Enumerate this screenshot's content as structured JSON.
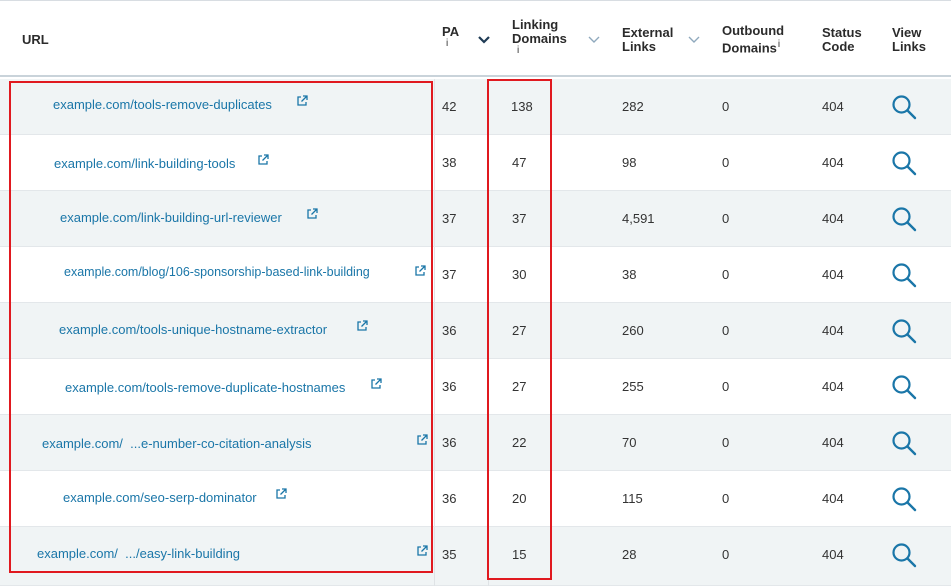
{
  "columns": {
    "url": "URL",
    "pa": "PA",
    "pa_info": "i",
    "linking_domains_1": "Linking",
    "linking_domains_2": "Domains",
    "linking_info": "i",
    "external_links_1": "External",
    "external_links_2": "Links",
    "outbound_domains_1": "Outbound",
    "outbound_domains_2": "Domains",
    "outbound_info": "i",
    "status_code_1": "Status",
    "status_code_2": "Code",
    "view_links_1": "View",
    "view_links_2": "Links"
  },
  "rows": [
    {
      "url": "example.com/tools-remove-duplicates",
      "pa": "42",
      "linking_domains": "138",
      "external_links": "282",
      "outbound_domains": "0",
      "status_code": "404"
    },
    {
      "url": "example.com/link-building-tools",
      "pa": "38",
      "linking_domains": "47",
      "external_links": "98",
      "outbound_domains": "0",
      "status_code": "404"
    },
    {
      "url": "example.com/link-building-url-reviewer",
      "pa": "37",
      "linking_domains": "37",
      "external_links": "4,591",
      "outbound_domains": "0",
      "status_code": "404"
    },
    {
      "url": "example.com/blog/106-sponsorship-based-link-building",
      "pa": "37",
      "linking_domains": "30",
      "external_links": "38",
      "outbound_domains": "0",
      "status_code": "404"
    },
    {
      "url": "example.com/tools-unique-hostname-extractor",
      "pa": "36",
      "linking_domains": "27",
      "external_links": "260",
      "outbound_domains": "0",
      "status_code": "404"
    },
    {
      "url": "example.com/tools-remove-duplicate-hostnames",
      "pa": "36",
      "linking_domains": "27",
      "external_links": "255",
      "outbound_domains": "0",
      "status_code": "404"
    },
    {
      "url": "example.com/  ...e-number-co-citation-analysis",
      "pa": "36",
      "linking_domains": "22",
      "external_links": "70",
      "outbound_domains": "0",
      "status_code": "404"
    },
    {
      "url": "example.com/seo-serp-dominator",
      "pa": "36",
      "linking_domains": "20",
      "external_links": "115",
      "outbound_domains": "0",
      "status_code": "404"
    },
    {
      "url": "example.com/  .../easy-link-building",
      "pa": "35",
      "linking_domains": "15",
      "external_links": "28",
      "outbound_domains": "0",
      "status_code": "404"
    }
  ],
  "icons": {
    "external": "external-link-icon",
    "view": "search-icon",
    "sort_active": "chevron-down-icon",
    "sort_inactive": "chevron-down-icon"
  },
  "colors": {
    "link": "#1a76a8",
    "highlight": "#e0191f",
    "row_alt": "#f0f4f5"
  }
}
